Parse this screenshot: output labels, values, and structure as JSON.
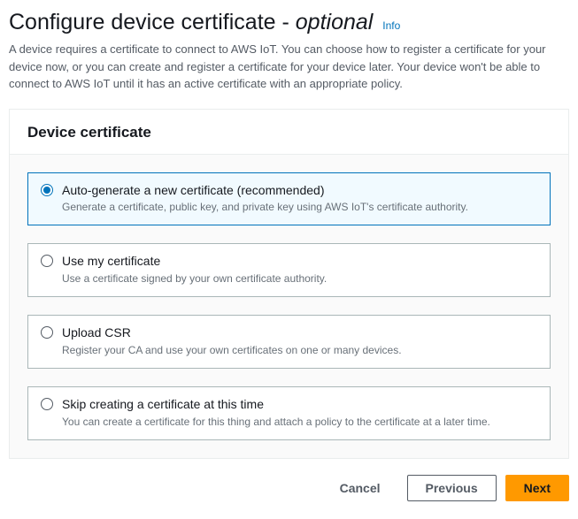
{
  "header": {
    "title_main": "Configure device certificate - ",
    "title_optional": "optional",
    "info_label": "Info",
    "description": "A device requires a certificate to connect to AWS IoT. You can choose how to register a certificate for your device now, or you can create and register a certificate for your device later. Your device won't be able to connect to AWS IoT until it has an active certificate with an appropriate policy."
  },
  "panel": {
    "title": "Device certificate",
    "options": [
      {
        "id": "auto-generate",
        "title": "Auto-generate a new certificate (recommended)",
        "description": "Generate a certificate, public key, and private key using AWS IoT's certificate authority.",
        "selected": true
      },
      {
        "id": "use-my-certificate",
        "title": "Use my certificate",
        "description": "Use a certificate signed by your own certificate authority.",
        "selected": false
      },
      {
        "id": "upload-csr",
        "title": "Upload CSR",
        "description": "Register your CA and use your own certificates on one or many devices.",
        "selected": false
      },
      {
        "id": "skip",
        "title": "Skip creating a certificate at this time",
        "description": "You can create a certificate for this thing and attach a policy to the certificate at a later time.",
        "selected": false
      }
    ]
  },
  "footer": {
    "cancel": "Cancel",
    "previous": "Previous",
    "next": "Next"
  }
}
